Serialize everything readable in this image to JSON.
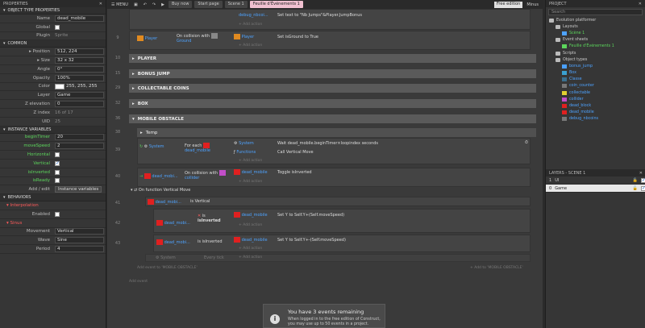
{
  "left": {
    "title": "PROPERTIES",
    "sec_object": "OBJECT TYPE PROPERTIES",
    "name_label": "Name",
    "name_value": "dead_mobile",
    "global_label": "Global",
    "plugin_label": "Plugin",
    "plugin_value": "Sprite",
    "sec_common": "COMMON",
    "position_label": "Position",
    "position_value": "512, 224",
    "size_label": "Size",
    "size_value": "32 x 32",
    "angle_label": "Angle",
    "angle_value": "0°",
    "opacity_label": "Opacity",
    "opacity_value": "100%",
    "color_label": "Color",
    "color_value": "255, 255, 255",
    "layer_label": "Layer",
    "layer_value": "Game",
    "zelev_label": "Z elevation",
    "zelev_value": "0",
    "zindex_label": "Z index",
    "zindex_value": "16 of 17",
    "uid_label": "UID",
    "uid_value": "25",
    "sec_ivars": "INSTANCE VARIABLES",
    "ivars": [
      {
        "label": "beginTimer",
        "value": "20"
      },
      {
        "label": "moveSpeed",
        "value": "2"
      },
      {
        "label": "Horizontal",
        "value": ""
      },
      {
        "label": "Vertical",
        "value": ""
      },
      {
        "label": "isInverted",
        "value": ""
      },
      {
        "label": "isReady",
        "value": ""
      }
    ],
    "addedit_label": "Add / edit",
    "addedit_btn": "Instance variables",
    "sec_behaviors": "BEHAVIORS",
    "interp_label": "Interpolation",
    "enabled_label": "Enabled",
    "sinus_label": "Sinus",
    "movement_label": "Movement",
    "movement_value": "Vertical",
    "wave_label": "Wave",
    "wave_value": "Sine",
    "period_label": "Period",
    "period_value": "4"
  },
  "topbar": {
    "menu": "MENU",
    "buy": "Buy now",
    "start": "Start page",
    "scene": "Scene 1",
    "sheet": "Feuille d'Événements 1",
    "free": "Free edition",
    "user": "Minus"
  },
  "sheet": {
    "e0_act1": "debug_nbcoi...",
    "e0_act1b": "Set text to \"Nb Jumps\"&Player.JumpBonus",
    "e0_add": "+ Add action",
    "e9_obj": "Player",
    "e9_cond": "On collision with",
    "e9_cond2": "Ground",
    "e9_act_obj": "Player",
    "e9_act": "Set isGround to True",
    "e9_add": "+ Add action",
    "g_player": "PLAYER",
    "g_bonus": "BONUS JUMP",
    "g_coins": "COLLECTABLE COINS",
    "g_box": "BOX",
    "g_mobile": "MOBILE OBSTACLE",
    "n10": "10",
    "n15": "15",
    "n29": "29",
    "n32": "32",
    "n36": "36",
    "n38": "38",
    "n39": "39",
    "n40": "40",
    "n41": "41",
    "n42": "42",
    "n43": "43",
    "n9": "9",
    "temp": "Temp",
    "e39_sys": "System",
    "e39_cond": "For each",
    "e39_cond2": "dead_mobile",
    "e39_a1obj": "System",
    "e39_a1": "Wait dead_mobile.beginTimer×loopindex seconds",
    "e39_a2obj": "Functions",
    "e39_a2": "Call Vertical Move",
    "e39_add": "+ Add action",
    "e40_obj": "dead_mobi...",
    "e40_cond": "On collision with",
    "e40_cond2": "collider",
    "e40_aobj": "dead_mobile",
    "e40_a": "Toggle isInverted",
    "e40_add": "+ Add action",
    "fn": "On function Vertical Move",
    "e41_obj": "dead_mobi...",
    "e41_cond": "is Vertical",
    "e42_obj": "dead_mobi...",
    "e42_cond": "is",
    "e42_cond2": "isInverted",
    "e42_aobj": "dead_mobile",
    "e42_a": "Set Y to Self.Y+(Self.moveSpeed)",
    "e42_add": "+ Add action",
    "e43_obj": "dead_mobi...",
    "e43_cond": "is isInverted",
    "e43_aobj": "dead_mobile",
    "e43_a": "Set Y to Self.Y+-(Self.moveSpeed)",
    "e43_add": "+ Add action",
    "e44_sys": "System",
    "e44_cond": "Every tick",
    "e44_add": "+ Add action",
    "addev_group": "Add event to 'MOBILE OBSTACLE'",
    "addto_group": "+ Add to 'MOBILE OBSTACLE'",
    "addev": "Add event"
  },
  "right": {
    "title": "PROJECT",
    "search": "Search",
    "tree": [
      {
        "label": "Evolution platformer",
        "indent": 0,
        "kind": "folder"
      },
      {
        "label": "Layouts",
        "indent": 1,
        "kind": "folder"
      },
      {
        "label": "Scène 1",
        "indent": 2,
        "kind": "layout"
      },
      {
        "label": "Event sheets",
        "indent": 1,
        "kind": "folder"
      },
      {
        "label": "Feuille d'Événements 1",
        "indent": 2,
        "kind": "sheet"
      },
      {
        "label": "Scripts",
        "indent": 1,
        "kind": "folder"
      },
      {
        "label": "Object types",
        "indent": 1,
        "kind": "folder"
      },
      {
        "label": "bonus_jump",
        "indent": 2,
        "kind": "obj",
        "color": "#4aa0ff"
      },
      {
        "label": "Box",
        "indent": 2,
        "kind": "obj",
        "color": "#3aa0d0"
      },
      {
        "label": "Classe",
        "indent": 2,
        "kind": "obj",
        "color": "#3a7090"
      },
      {
        "label": "coin_counter",
        "indent": 2,
        "kind": "obj",
        "color": "#777"
      },
      {
        "label": "collectable",
        "indent": 2,
        "kind": "obj",
        "color": "#e0d030"
      },
      {
        "label": "collider",
        "indent": 2,
        "kind": "obj",
        "color": "#c24ec9"
      },
      {
        "label": "dead_block",
        "indent": 2,
        "kind": "obj",
        "color": "#e02020"
      },
      {
        "label": "dead_mobile",
        "indent": 2,
        "kind": "obj",
        "color": "#e02020"
      },
      {
        "label": "debug_nbcoins",
        "indent": 2,
        "kind": "obj",
        "color": "#777"
      }
    ],
    "layers_title": "LAYERS - SCENE 1",
    "layers": [
      {
        "idx": "1",
        "name": "UI"
      },
      {
        "idx": "0",
        "name": "Game"
      }
    ]
  },
  "notice": {
    "title": "You have 3 events remaining",
    "sub1": "When logged in to the free edition of Construct,",
    "sub2": "you may use up to 50 events in a project."
  }
}
